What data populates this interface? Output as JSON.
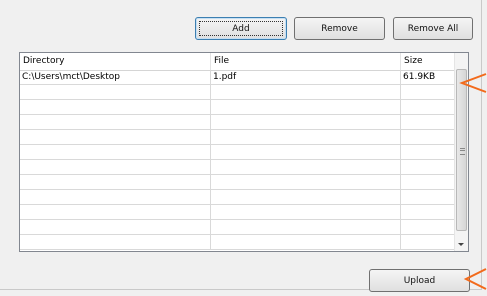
{
  "toolbar": {
    "add_label": "Add",
    "remove_label": "Remove",
    "remove_all_label": "Remove All"
  },
  "table": {
    "columns": [
      "Directory",
      "File",
      "Size"
    ],
    "rows": [
      [
        "C:\\Users\\mct\\Desktop",
        "1.pdf",
        "61.9KB"
      ],
      [
        "",
        "",
        ""
      ],
      [
        "",
        "",
        ""
      ],
      [
        "",
        "",
        ""
      ],
      [
        "",
        "",
        ""
      ],
      [
        "",
        "",
        ""
      ],
      [
        "",
        "",
        ""
      ],
      [
        "",
        "",
        ""
      ],
      [
        "",
        "",
        ""
      ],
      [
        "",
        "",
        ""
      ],
      [
        "",
        "",
        ""
      ],
      [
        "",
        "",
        ""
      ]
    ]
  },
  "footer": {
    "upload_label": "Upload"
  },
  "colors": {
    "annotation_arrow": "#f26a1b",
    "grid_border": "#828790"
  }
}
